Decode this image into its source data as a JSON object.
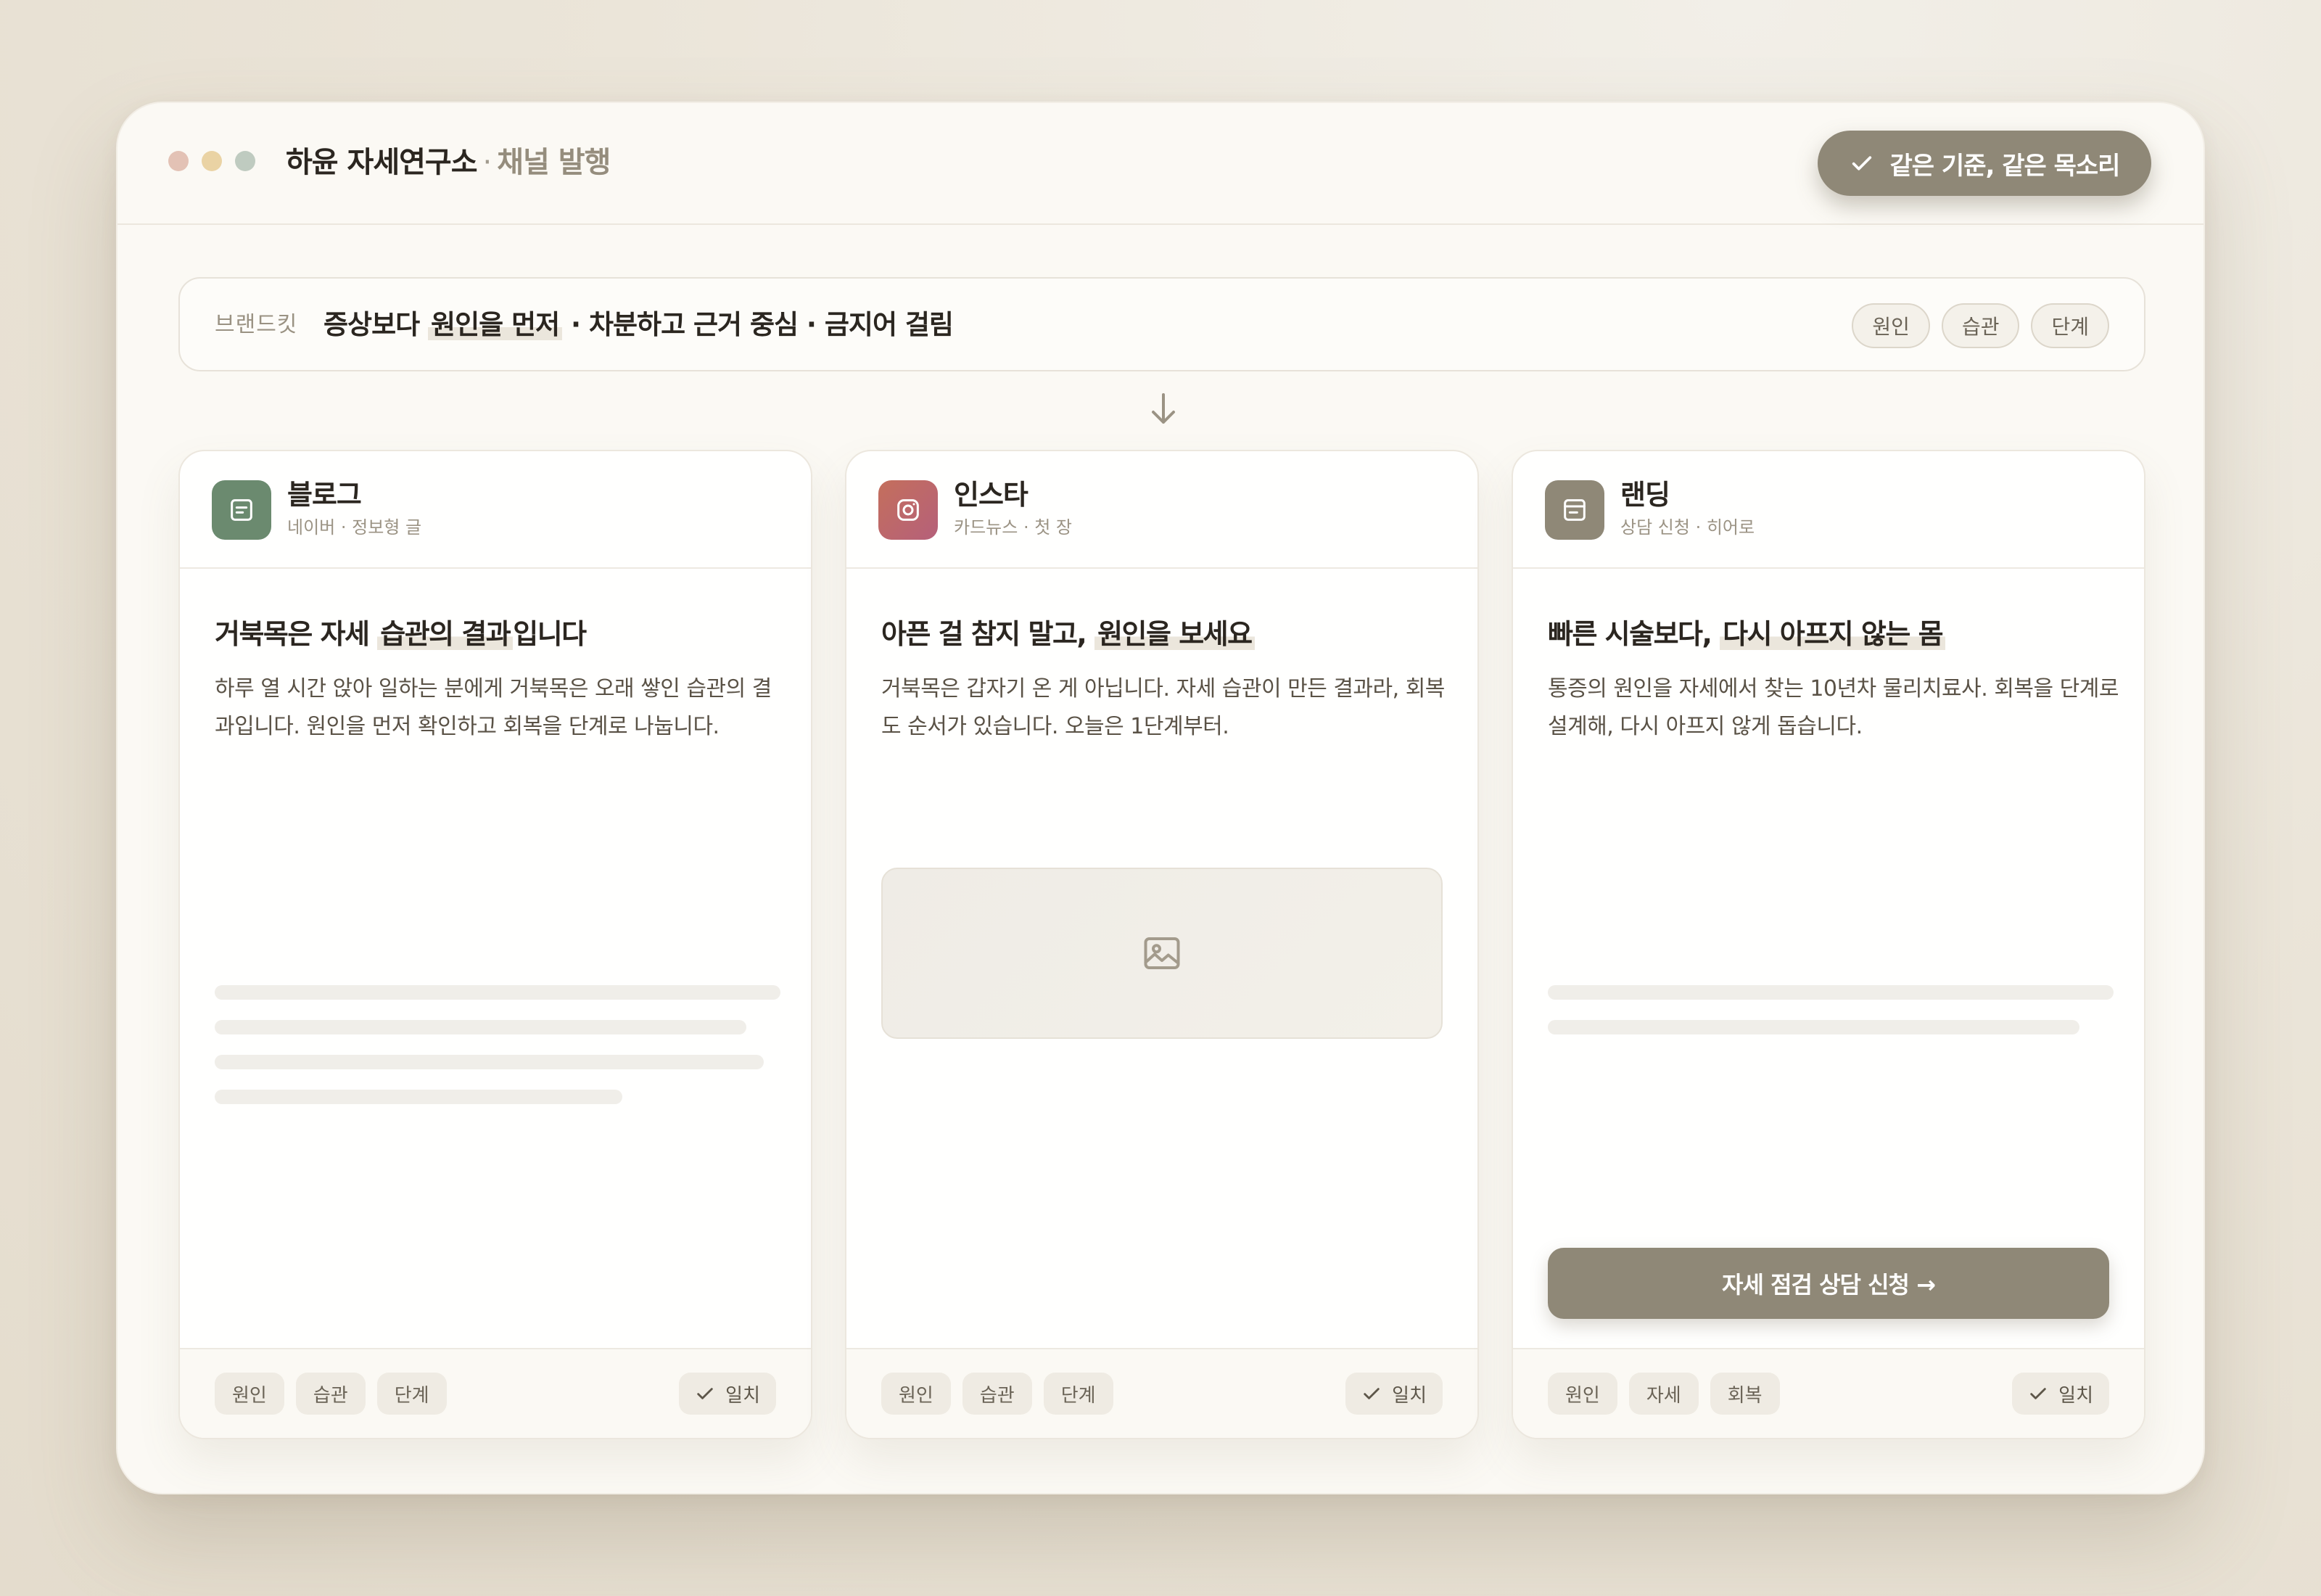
{
  "window": {
    "title": "하윤 자세연구소",
    "title_sep": "·",
    "subtitle": "채널 발행",
    "dots": [
      "#e3c2b5",
      "#ead3a4",
      "#bfcbc0"
    ],
    "badge_label": "같은 기준, 같은 목소리"
  },
  "brand_kit": {
    "label": "브랜드킷",
    "text_before": "증상보다 ",
    "text_highlight": "원인을 먼저",
    "text_after": " · 차분하고 근거 중심 · 금지어 걸림",
    "chips": [
      "원인",
      "습관",
      "단계"
    ]
  },
  "colors": {
    "accent": "#8f8877",
    "blog": "#6b8a6f",
    "insta_start": "#c46f5c",
    "insta_end": "#b5607a",
    "landing": "#8f8877"
  },
  "cards": [
    {
      "channel": "블로그",
      "channel_sub": "네이버 · 정보형 글",
      "icon": "document-icon",
      "title_before": "거북목은 자세 ",
      "title_highlight": "습관의 결과",
      "title_after": "입니다",
      "body": "하루 열 시간 앉아 일하는 분에게 거북목은 오래 쌓인 습관의 결과입니다. 원인을 먼저 확인하고 회복을 단계로 나눕니다.",
      "tags": [
        "원인",
        "습관",
        "단계"
      ],
      "match_label": "일치"
    },
    {
      "channel": "인스타",
      "channel_sub": "카드뉴스 · 첫 장",
      "icon": "instagram-icon",
      "title_before": "아픈 걸 참지 말고, ",
      "title_highlight": "원인을 보세요",
      "title_after": "",
      "body": "거북목은 갑자기 온 게 아닙니다. 자세 습관이 만든 결과라, 회복도 순서가 있습니다. 오늘은 1단계부터.",
      "tags": [
        "원인",
        "습관",
        "단계"
      ],
      "match_label": "일치"
    },
    {
      "channel": "랜딩",
      "channel_sub": "상담 신청 · 히어로",
      "icon": "landing-page-icon",
      "title_before": "빠른 시술보다, ",
      "title_highlight": "다시 아프지 않는 몸",
      "title_after": "",
      "body": "통증의 원인을 자세에서 찾는 10년차 물리치료사. 회복을 단계로 설계해, 다시 아프지 않게 돕습니다.",
      "cta_label": "자세 점검 상담 신청 →",
      "tags": [
        "원인",
        "자세",
        "회복"
      ],
      "match_label": "일치"
    }
  ]
}
